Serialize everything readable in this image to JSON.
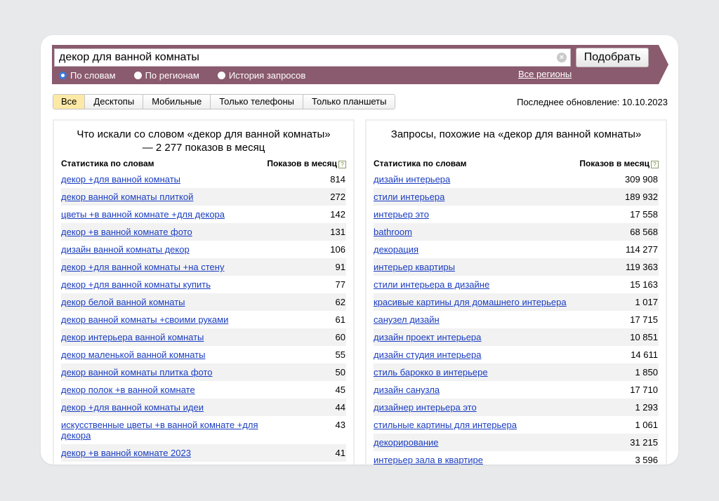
{
  "search": {
    "value": "декор для ванной комнаты",
    "submit_label": "Подобрать"
  },
  "modes": [
    {
      "label": "По словам",
      "checked": true
    },
    {
      "label": "По регионам",
      "checked": false
    },
    {
      "label": "История запросов",
      "checked": false
    }
  ],
  "regions_link": "Все регионы",
  "device_tabs": [
    {
      "label": "Все",
      "active": true
    },
    {
      "label": "Десктопы",
      "active": false
    },
    {
      "label": "Мобильные",
      "active": false
    },
    {
      "label": "Только телефоны",
      "active": false
    },
    {
      "label": "Только планшеты",
      "active": false
    }
  ],
  "last_update": "Последнее обновление: 10.10.2023",
  "left_panel": {
    "title": "Что искали со словом «декор для ванной комнаты» — 2 277 показов в месяц",
    "col_query": "Статистика по словам",
    "col_count": "Показов в месяц",
    "rows": [
      {
        "q": "декор +для ванной комнаты",
        "n": "814"
      },
      {
        "q": "декор ванной комнаты плиткой",
        "n": "272"
      },
      {
        "q": "цветы +в ванной комнате +для декора",
        "n": "142"
      },
      {
        "q": "декор +в ванной комнате фото",
        "n": "131"
      },
      {
        "q": "дизайн ванной комнаты декор",
        "n": "106"
      },
      {
        "q": "декор +для ванной комнаты +на стену",
        "n": "91"
      },
      {
        "q": "декор +для ванной комнаты купить",
        "n": "77"
      },
      {
        "q": "декор белой ванной комнаты",
        "n": "62"
      },
      {
        "q": "декор ванной комнаты +своими руками",
        "n": "61"
      },
      {
        "q": "декор интерьера ванной комнаты",
        "n": "60"
      },
      {
        "q": "декор маленькой ванной комнаты",
        "n": "55"
      },
      {
        "q": "декор ванной комнаты плитка фото",
        "n": "50"
      },
      {
        "q": "декор полок +в ванной комнате",
        "n": "45"
      },
      {
        "q": "декор +для ванной комнаты идеи",
        "n": "44"
      },
      {
        "q": "искусственные цветы +в ванной комнате +для декора",
        "n": "43"
      },
      {
        "q": "декор +в ванной комнате 2023",
        "n": "41"
      }
    ]
  },
  "right_panel": {
    "title": "Запросы, похожие на «декор для ванной комнаты»",
    "col_query": "Статистика по словам",
    "col_count": "Показов в месяц",
    "rows": [
      {
        "q": "дизайн интерьера",
        "n": "309 908"
      },
      {
        "q": "стили интерьера",
        "n": "189 932"
      },
      {
        "q": "интерьер это",
        "n": "17 558"
      },
      {
        "q": "bathroom",
        "n": "68 568"
      },
      {
        "q": "декорация",
        "n": "114 277"
      },
      {
        "q": "интерьер квартиры",
        "n": "119 363"
      },
      {
        "q": "стили интерьера в дизайне",
        "n": "15 163"
      },
      {
        "q": "красивые картины для домашнего интерьера",
        "n": "1 017"
      },
      {
        "q": "санузел дизайн",
        "n": "17 715"
      },
      {
        "q": "дизайн проект интерьера",
        "n": "10 851"
      },
      {
        "q": "дизайн студия интерьера",
        "n": "14 611"
      },
      {
        "q": "стиль барокко в интерьере",
        "n": "1 850"
      },
      {
        "q": "дизайн санузла",
        "n": "17 710"
      },
      {
        "q": "дизайнер интерьера это",
        "n": "1 293"
      },
      {
        "q": "стильные картины для интерьера",
        "n": "1 061"
      },
      {
        "q": "декорирование",
        "n": "31 215"
      },
      {
        "q": "интерьер зала в квартире",
        "n": "3 596"
      }
    ]
  }
}
